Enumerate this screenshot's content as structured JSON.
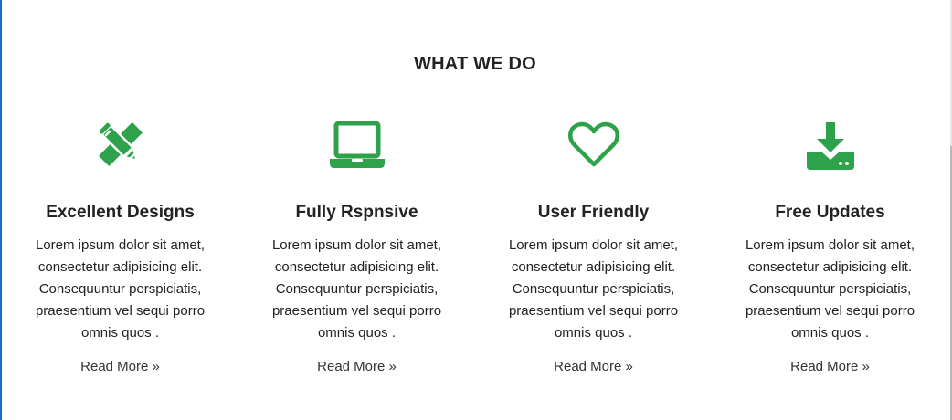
{
  "section": {
    "title": "WHAT WE DO"
  },
  "colors": {
    "accent": "#2ea14b"
  },
  "features": [
    {
      "icon": "pencil-ruler-icon",
      "title": "Excellent Designs",
      "text": "Lorem ipsum dolor sit amet, consectetur adipisicing elit. Consequuntur perspiciatis, praesentium vel sequi porro omnis quos .",
      "link": "Read More »"
    },
    {
      "icon": "laptop-icon",
      "title": "Fully Rspnsive",
      "text": "Lorem ipsum dolor sit amet, consectetur adipisicing elit. Consequuntur perspiciatis, praesentium vel sequi porro omnis quos .",
      "link": "Read More »"
    },
    {
      "icon": "heart-icon",
      "title": "User Friendly",
      "text": "Lorem ipsum dolor sit amet, consectetur adipisicing elit. Consequuntur perspiciatis, praesentium vel sequi porro omnis quos .",
      "link": "Read More »"
    },
    {
      "icon": "download-icon",
      "title": "Free Updates",
      "text": "Lorem ipsum dolor sit amet, consectetur adipisicing elit. Consequuntur perspiciatis, praesentium vel sequi porro omnis quos .",
      "link": "Read More »"
    }
  ]
}
